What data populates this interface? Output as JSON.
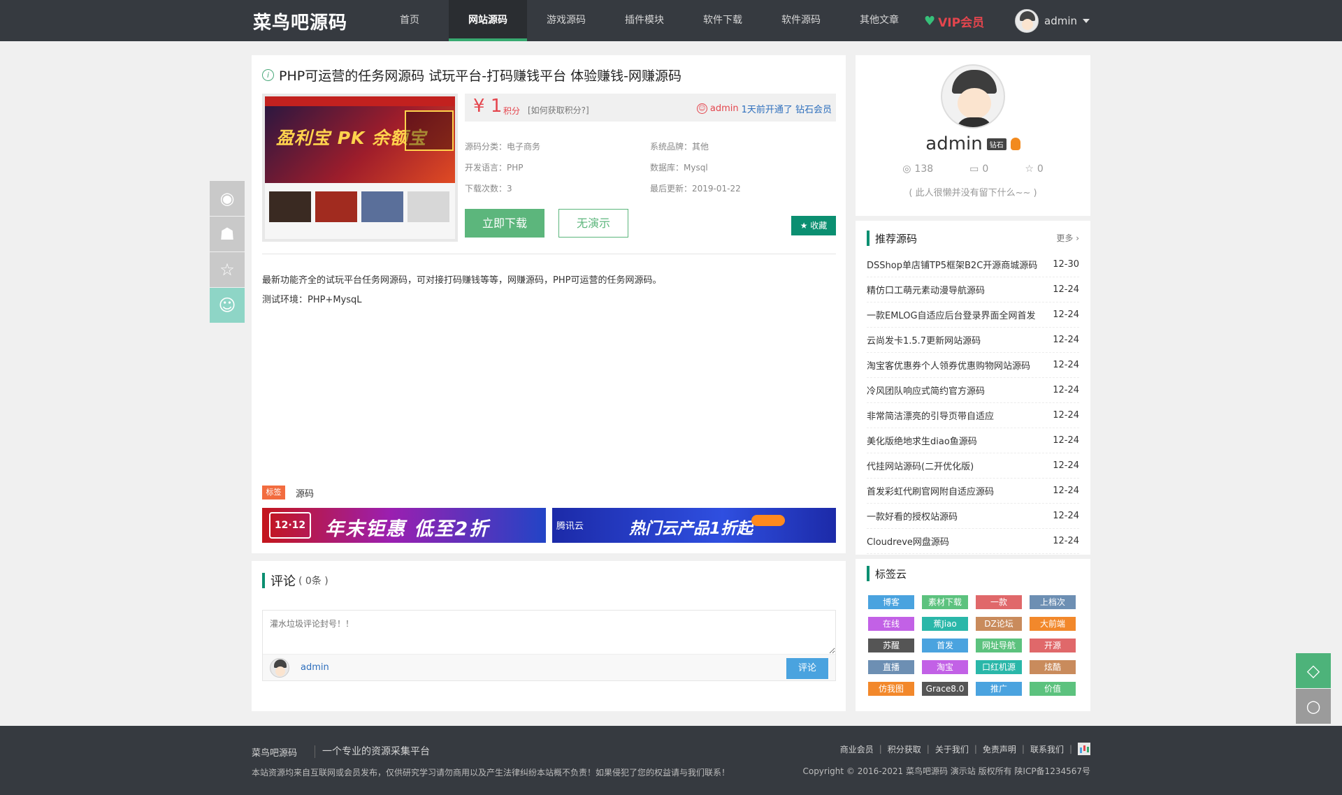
{
  "header": {
    "logo": "菜鸟吧源码",
    "nav": [
      "首页",
      "网站源码",
      "游戏源码",
      "插件模块",
      "软件下载",
      "软件源码",
      "其他文章"
    ],
    "active_nav": 1,
    "vip_label": "VIP会员",
    "username": "admin"
  },
  "article": {
    "title": "PHP可运营的任务网源码 试玩平台-打码赚钱平台 体验赚钱-网赚源码",
    "thumb_text": "盈利宝 PK 余额宝",
    "price_symbol": "¥",
    "price_value": "1",
    "price_unit": "积分",
    "price_how": "[如何获取积分?]",
    "notice_user": "admin",
    "notice_msg": "1天前开通了 钻石会员",
    "meta": [
      "源码分类：电子商务",
      "系统品牌：其他",
      "开发语言：PHP",
      "数据库：Mysql",
      "下载次数：3",
      "最后更新：2019-01-22"
    ],
    "download_label": "立即下载",
    "demo_label": "无演示",
    "favorite_label": "收藏",
    "desc1": "最新功能齐全的试玩平台任务网源码，可对接打码赚钱等等，网赚源码，PHP可运营的任务网源码。",
    "desc2": "测试环境：PHP+MysqL",
    "tag_label": "标签",
    "tag_value": "源码",
    "ad1_badge": "12·12",
    "ad1_text": "年末钜惠 低至2折",
    "ad2_brand": "腾讯云",
    "ad2_text": "热门云产品1折起"
  },
  "comments": {
    "title": "评论",
    "count": "( 0条 )",
    "placeholder": "灌水垃圾评论封号！！",
    "user": "admin",
    "submit": "评论"
  },
  "profile": {
    "name": "admin",
    "level": "钻石",
    "views": "138",
    "comments": "0",
    "stars": "0",
    "motto": "( 此人很懒并没有留下什么~~ )"
  },
  "recommend": {
    "title": "推荐源码",
    "more": "更多 ›",
    "items": [
      {
        "title": "DSShop单店铺TP5框架B2C开源商城源码",
        "date": "12-30"
      },
      {
        "title": "精仿口工萌元素动漫导航源码",
        "date": "12-24"
      },
      {
        "title": "一款EMLOG自适应后台登录界面全网首发",
        "date": "12-24"
      },
      {
        "title": "云尚发卡1.5.7更新网站源码",
        "date": "12-24"
      },
      {
        "title": "淘宝客优惠券个人领券优惠购物网站源码",
        "date": "12-24"
      },
      {
        "title": "冷风团队响应式简约官方源码",
        "date": "12-24"
      },
      {
        "title": "非常简洁漂亮的引导页带自适应",
        "date": "12-24"
      },
      {
        "title": "美化版绝地求生diao鱼源码",
        "date": "12-24"
      },
      {
        "title": "代挂网站源码(二开优化版)",
        "date": "12-24"
      },
      {
        "title": "首发彩虹代刷官网附自适应源码",
        "date": "12-24"
      },
      {
        "title": "一款好看的授权站源码",
        "date": "12-24"
      },
      {
        "title": "Cloudreve网盘源码",
        "date": "12-24"
      }
    ]
  },
  "tagcloud": {
    "title": "标签云",
    "tags": [
      {
        "label": "博客",
        "color": "#4aa3df"
      },
      {
        "label": "素材下载",
        "color": "#5cc27e"
      },
      {
        "label": "一款",
        "color": "#e0686a"
      },
      {
        "label": "上档次",
        "color": "#6d8fb3"
      },
      {
        "label": "在线",
        "color": "#c261e6"
      },
      {
        "label": "蕉Jiao",
        "color": "#2ab7a9"
      },
      {
        "label": "DZ论坛",
        "color": "#c98b5c"
      },
      {
        "label": "大前端",
        "color": "#f2882b"
      },
      {
        "label": "苏醒",
        "color": "#555555"
      },
      {
        "label": "首发",
        "color": "#4aa3df"
      },
      {
        "label": "网址导航",
        "color": "#5cc27e"
      },
      {
        "label": "开源",
        "color": "#e0686a"
      },
      {
        "label": "直播",
        "color": "#6d8fb3"
      },
      {
        "label": "淘宝",
        "color": "#c261e6"
      },
      {
        "label": "口红机源",
        "color": "#2ab7a9"
      },
      {
        "label": "炫酷",
        "color": "#c98b5c"
      },
      {
        "label": "仿我图",
        "color": "#f2882b"
      },
      {
        "label": "Grace8.0",
        "color": "#555555"
      },
      {
        "label": "推广",
        "color": "#4aa3df"
      },
      {
        "label": "价值",
        "color": "#5cc27e"
      }
    ]
  },
  "footer": {
    "brand": "菜鸟吧源码",
    "slogan": "一个专业的资源采集平台",
    "notice": "本站资源均来自互联网或会员发布，仅供研究学习请勿商用以及产生法律纠纷本站概不负责！如果侵犯了您的权益请与我们联系！",
    "links": [
      "商业会员",
      "积分获取",
      "关于我们",
      "免责声明",
      "联系我们"
    ],
    "copyright": "Copyright © 2016-2021 菜鸟吧源码 演示站 版权所有 陕ICP备1234567号"
  }
}
